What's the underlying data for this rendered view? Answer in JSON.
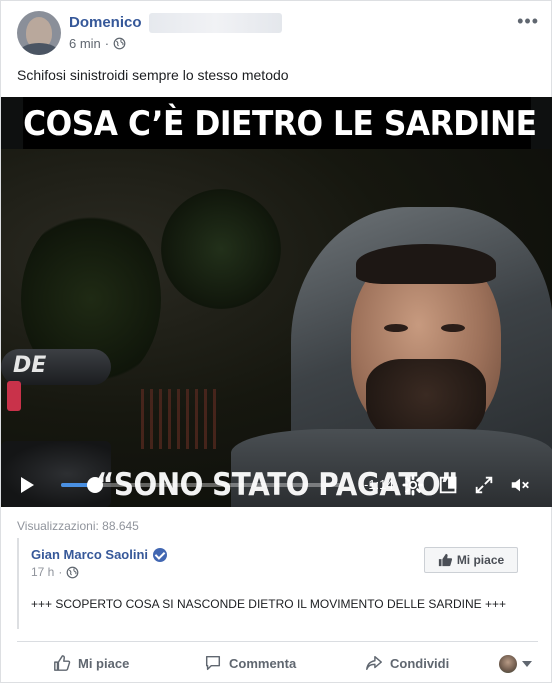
{
  "post": {
    "author": "Domenico",
    "time": "6 min",
    "caption": "Schifosi sinistroidi sempre lo stesso metodo",
    "more_icon": "more-options-icon"
  },
  "video": {
    "title_banner": "COSA C’È DIETRO LE SARDINE",
    "overlay_text": "“SONO STATO PAGATO”",
    "mic_brand": "DE",
    "time_remaining": "-1:14",
    "progress_fraction": 0.12
  },
  "stats": {
    "views_label": "Visualizzazioni: 88.645"
  },
  "shared": {
    "author": "Gian Marco Saolini",
    "time": "17 h",
    "like_button": "Mi piace",
    "text": "+++ SCOPERTO COSA SI NASCONDE DIETRO IL MOVIMENTO DELLE SARDINE +++"
  },
  "actions": {
    "like": "Mi piace",
    "comment": "Commenta",
    "share": "Condividi"
  },
  "colors": {
    "link": "#365899",
    "accent": "#4a90e2",
    "muted": "#606770"
  }
}
